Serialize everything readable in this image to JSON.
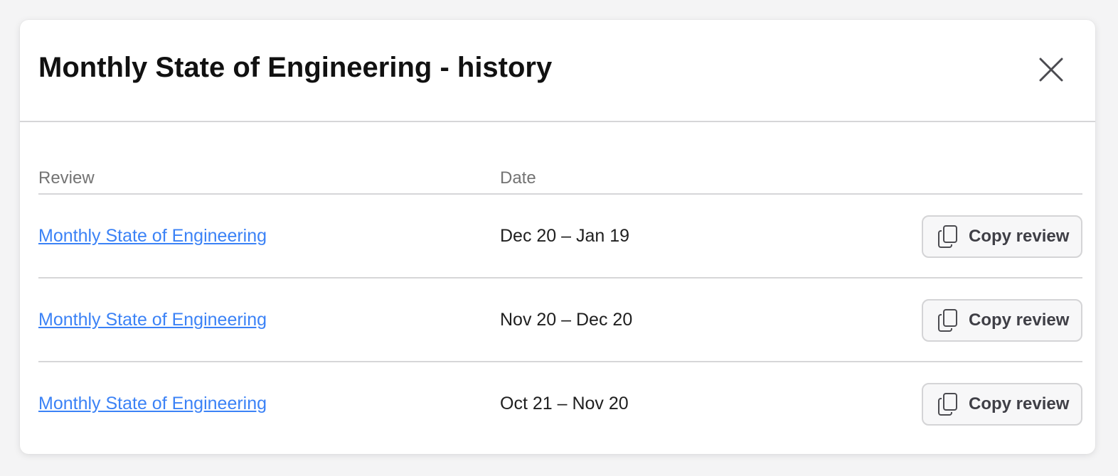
{
  "modal": {
    "title": "Monthly State of Engineering - history",
    "close_icon": "close-icon"
  },
  "table": {
    "columns": {
      "review": "Review",
      "date": "Date"
    },
    "rows": [
      {
        "review": "Monthly State of Engineering",
        "date": "Dec 20 – Jan 19",
        "action_label": "Copy review",
        "action_icon": "copy-icon"
      },
      {
        "review": "Monthly State of Engineering",
        "date": "Nov 20 – Dec 20",
        "action_label": "Copy review",
        "action_icon": "copy-icon"
      },
      {
        "review": "Monthly State of Engineering",
        "date": "Oct 21 – Nov 20",
        "action_label": "Copy review",
        "action_icon": "copy-icon"
      }
    ]
  },
  "colors": {
    "link": "#3b82f6",
    "divider": "#d6d6d8",
    "muted_text": "#737373",
    "button_bg": "#f7f7f8"
  }
}
